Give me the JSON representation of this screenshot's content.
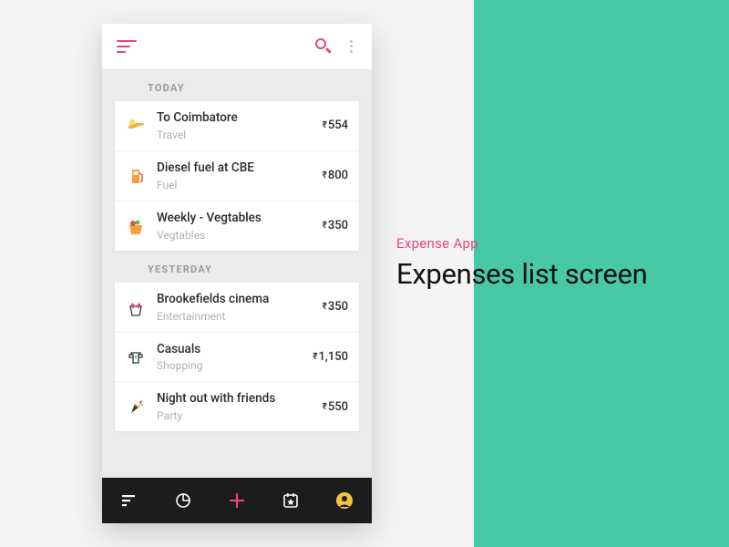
{
  "caption": {
    "subtitle": "Expense App",
    "title": "Expenses list screen"
  },
  "currency_symbol": "₹",
  "sections": [
    {
      "header": "TODAY",
      "items": [
        {
          "title": "To Coimbatore",
          "category": "Travel",
          "amount": "554",
          "icon": "travel"
        },
        {
          "title": "Diesel fuel at CBE",
          "category": "Fuel",
          "amount": "800",
          "icon": "fuel"
        },
        {
          "title": "Weekly - Vegtables",
          "category": "Vegtables",
          "amount": "350",
          "icon": "veg"
        }
      ]
    },
    {
      "header": "YESTERDAY",
      "items": [
        {
          "title": "Brookefields cinema",
          "category": "Entertainment",
          "amount": "350",
          "icon": "cinema"
        },
        {
          "title": "Casuals",
          "category": "Shopping",
          "amount": "1,150",
          "icon": "shopping"
        },
        {
          "title": "Night out with friends",
          "category": "Party",
          "amount": "550",
          "icon": "party"
        }
      ]
    }
  ],
  "colors": {
    "accent": "#e8457a",
    "teal": "#48c9a5",
    "dark": "#1d1c1c",
    "addfab": "#ff3b7a",
    "profile": "#f5c23e"
  }
}
